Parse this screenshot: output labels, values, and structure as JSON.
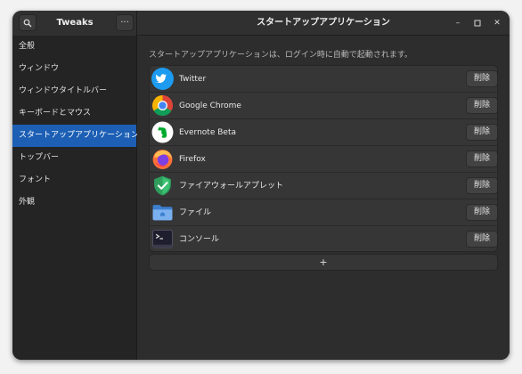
{
  "window": {
    "app_title": "Tweaks",
    "title": "スタートアップアプリケーション",
    "search_icon": "search-icon",
    "menu_label": "···",
    "minimize_label": "–",
    "maximize_label": "▫",
    "close_label": "✕"
  },
  "sidebar": {
    "items": [
      {
        "label": "全般",
        "active": false
      },
      {
        "label": "ウィンドウ",
        "active": false
      },
      {
        "label": "ウィンドウタイトルバー",
        "active": false
      },
      {
        "label": "キーボードとマウス",
        "active": false
      },
      {
        "label": "スタートアップアプリケーション",
        "active": true
      },
      {
        "label": "トップバー",
        "active": false
      },
      {
        "label": "フォント",
        "active": false
      },
      {
        "label": "外観",
        "active": false
      }
    ]
  },
  "main": {
    "description": "スタートアップアプリケーションは、ログイン時に自動で起動されます。",
    "remove_label": "削除",
    "add_label": "+",
    "apps": [
      {
        "name": "Twitter",
        "icon": "twitter-icon"
      },
      {
        "name": "Google Chrome",
        "icon": "chrome-icon"
      },
      {
        "name": "Evernote Beta",
        "icon": "evernote-icon"
      },
      {
        "name": "Firefox",
        "icon": "firefox-icon"
      },
      {
        "name": "ファイアウォールアプレット",
        "icon": "firewall-icon"
      },
      {
        "name": "ファイル",
        "icon": "files-icon"
      },
      {
        "name": "コンソール",
        "icon": "console-icon"
      }
    ]
  },
  "colors": {
    "accent": "#1c5fb4",
    "window_bg": "#2d2d2d",
    "sidebar_bg": "#242424"
  }
}
